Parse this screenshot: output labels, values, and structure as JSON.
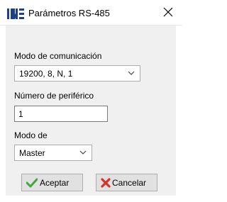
{
  "window": {
    "title": "Parámetros RS-485",
    "logo_text": "INE"
  },
  "comm_mode": {
    "label": "Modo de comunicación",
    "value": "19200, 8, N, 1"
  },
  "peripheral": {
    "label": "Número de periférico",
    "value": "1"
  },
  "mode": {
    "label": "Modo de",
    "value": "Master"
  },
  "buttons": {
    "accept": "Aceptar",
    "cancel": "Cancelar"
  },
  "icons": {
    "logo": "ine-logo",
    "close": "close-icon",
    "accept": "green-check-icon",
    "cancel": "red-x-icon",
    "dropdown": "chevron-down-icon"
  },
  "colors": {
    "logo_blue": "#1f3f8c",
    "check_green": "#3fa83a",
    "cancel_red": "#d8322a",
    "client_bg": "#f0f0f0",
    "button_bg": "#e1e1e1"
  }
}
